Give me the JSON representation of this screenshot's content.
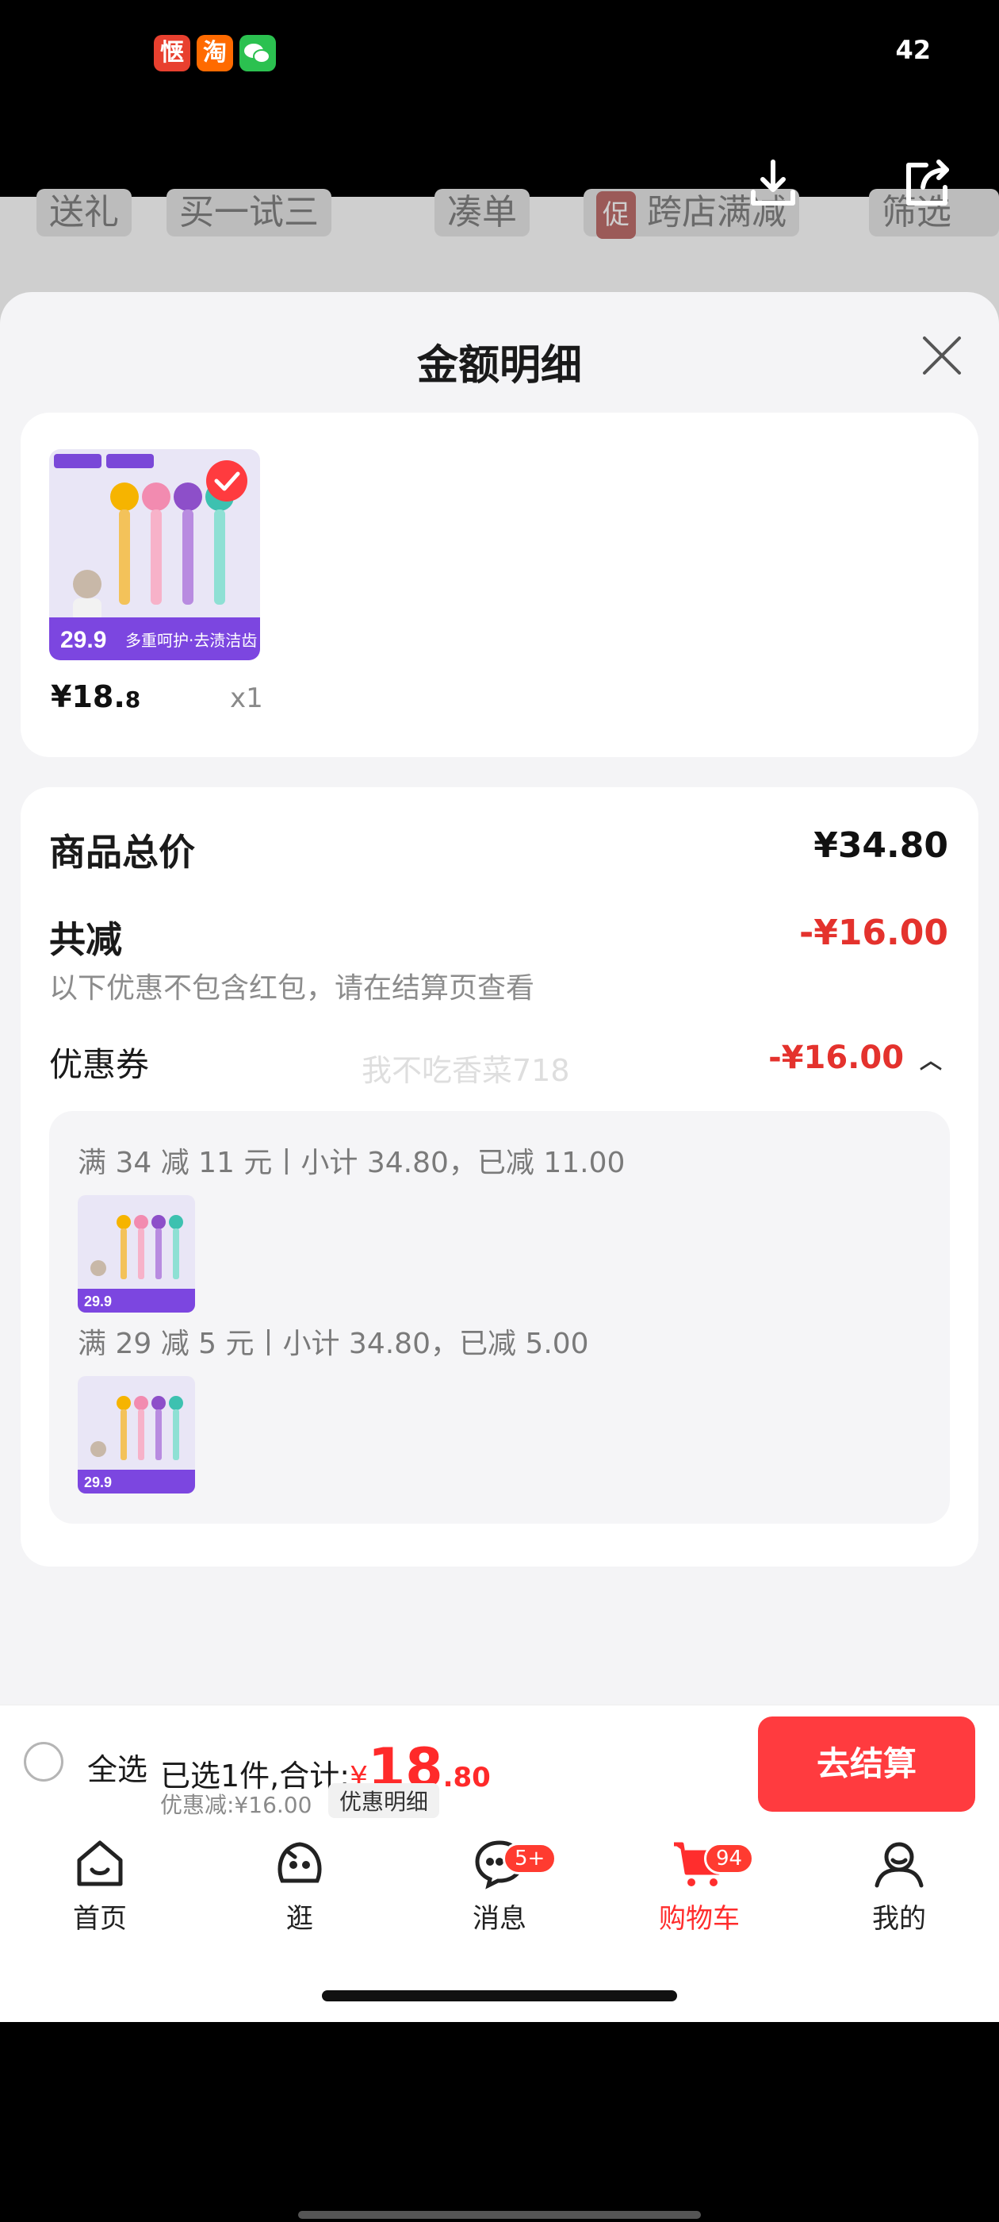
{
  "status_bar": {
    "time": "42",
    "apps": [
      {
        "name": "app-icon-1",
        "glyph": "惬",
        "color": "#e8402f"
      },
      {
        "name": "taobao-icon",
        "glyph": "淘",
        "color": "#ff6a00"
      },
      {
        "name": "wechat-icon",
        "glyph": "",
        "color": "#2bc150"
      }
    ]
  },
  "background": {
    "filters": [
      "送礼",
      "买一试三",
      "凑单",
      "跨店满减",
      "筛选"
    ],
    "promo_tag": "促"
  },
  "sheet": {
    "title": "金额明细",
    "product": {
      "price_main": "¥18.",
      "price_decimal": "8",
      "qty": "x1"
    },
    "total_label": "商品总价",
    "total_value": "¥34.80",
    "reduce_label": "共减",
    "reduce_value": "-¥16.00",
    "reduce_note": "以下优惠不包含红包，请在结算页查看",
    "coupon_label": "优惠券",
    "coupon_value": "-¥16.00",
    "watermark": "我不吃香菜718",
    "coupons": [
      {
        "text": "满 34 减 11 元丨小计 34.80，已减 11.00"
      },
      {
        "text": "满 29 减 5 元丨小计 34.80，已减 5.00"
      }
    ]
  },
  "checkout": {
    "select_all": "全选",
    "summary_prefix": "已选1件,合计:",
    "currency": "¥",
    "amount_int": "18",
    "amount_dec": ".80",
    "discount": "优惠减:¥16.00",
    "detail_chip": "优惠明细",
    "button": "去结算"
  },
  "tabbar": {
    "items": [
      {
        "label": "首页"
      },
      {
        "label": "逛"
      },
      {
        "label": "消息",
        "badge": "5+"
      },
      {
        "label": "购物车",
        "badge": "94"
      },
      {
        "label": "我的"
      }
    ]
  },
  "colors": {
    "accent": "#ff3b3f",
    "price_red": "#e4322d"
  }
}
